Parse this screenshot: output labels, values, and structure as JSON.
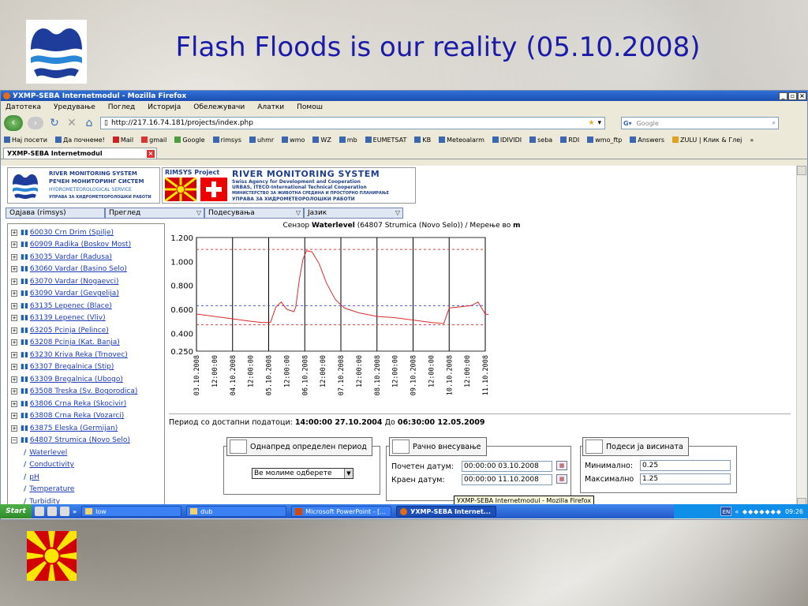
{
  "slide": {
    "title": "Flash Floods is our reality (05.10.2008)"
  },
  "browser": {
    "window_title": "УХМР-SEBA Internetmodul - Mozilla Firefox",
    "menu": [
      "Датотека",
      "Уредување",
      "Поглед",
      "Историја",
      "Обележувачи",
      "Алатки",
      "Помош"
    ],
    "url": "http://217.16.74.181/projects/index.php",
    "search_placeholder": "Google",
    "bookmarks": [
      "Нај посети",
      "Да почнеме!",
      "Mail",
      "gmail",
      "Google",
      "rimsys",
      "uhmr",
      "wmo",
      "WZ",
      "mb",
      "EUMETSAT",
      "KB",
      "Meteoalarm",
      "IDIVIDI",
      "seba",
      "RDI",
      "wmo_ftp",
      "Answers",
      "ZULU | Клик & Глеј"
    ],
    "tab_label": "УХМР-SEBA Internetmodul"
  },
  "logos": {
    "left": {
      "line1": "RIVER MONITORING SYSTEM",
      "line2": "РЕЧЕН МОНИТОРИНГ СИСТЕМ",
      "line3": "HYDROMETEOROLOGICAL SERVICE",
      "line4": "УПРАВА ЗА ХИДРОМЕТЕОРОЛОШКИ РАБОТИ"
    },
    "right": {
      "project": "RIMSYS Project",
      "line1": "RIVER MONITORING SYSTEM",
      "line2": "Swiss Agency for Development and Cooperation",
      "line3": "URBAS, ITECO-International Technical Cooperation",
      "line4": "МИНИСТЕРСТВО ЗА ЖИВОТНА СРЕДИНА И ПРОСТОРНО ПЛАНИРАЊЕ",
      "line5": "УПРАВА ЗА ХИДРОМЕТЕОРОЛОШКИ РАБОТИ"
    }
  },
  "app_menu": [
    "Одјава (rimsys)",
    "Преглед",
    "Подесувања",
    "Јазик"
  ],
  "stations": [
    "60030 Crn Drim (Spilje)",
    "60909 Radika (Boskov Most)",
    "63035 Vardar (Radusa)",
    "63060 Vardar (Basino Selo)",
    "63070 Vardar (Nogaevci)",
    "63090 Vardar (Gevgelija)",
    "63135 Lepenec (Blace)",
    "63139 Lepenec (Vliv)",
    "63205 Pcinja (Pelince)",
    "63208 Pcinja (Kat. Banja)",
    "63230 Kriva Reka (Trnovec)",
    "63307 Bregalnica (Stip)",
    "63309 Bregalnica (Ubogo)",
    "63508 Treska (Sv. Bogorodica)",
    "63806 Crna Reka (Skocivir)",
    "63808 Crna Reka (Vozarci)",
    "63875 Eleska (Germijan)",
    "64807 Strumica (Novo Selo)"
  ],
  "station_children": [
    "Waterlevel",
    "Conductivity",
    "pH",
    "Temperature",
    "Turbidity"
  ],
  "chart_caption": {
    "prefix": "Сензор",
    "sensor": "Waterlevel",
    "station": "(64807 Strumica (Novo Selo))",
    "unit_text": "/ Мерење во",
    "unit": "m"
  },
  "chart_data": {
    "type": "line",
    "title": "Сензор Waterlevel (64807 Strumica (Novo Selo)) / Мерење во m",
    "xlabel": "",
    "ylabel": "",
    "ylim": [
      0.25,
      1.2
    ],
    "yticks": [
      "1.200",
      "1.000",
      "0.800",
      "0.600",
      "0.400",
      "0.250"
    ],
    "xticks": [
      "03.10.2008",
      "12:00:00",
      "04.10.2008",
      "12:00:00",
      "05.10.2008",
      "12:00:00",
      "06.10.2008",
      "12:00:00",
      "07.10.2008",
      "12:00:00",
      "08.10.2008",
      "12:00:00",
      "09.10.2008",
      "12:00:00",
      "10.10.2008",
      "12:00:00",
      "11.10.2008"
    ],
    "day_markers": [
      0,
      1,
      2,
      3,
      4,
      5,
      6,
      7,
      8
    ],
    "x_unit": "days since 03.10.2008",
    "reference_lines": [
      {
        "value": 1.1,
        "color": "#e04040",
        "style": "dashed"
      },
      {
        "value": 0.63,
        "color": "#4a5ad8",
        "style": "dashed"
      },
      {
        "value": 0.47,
        "color": "#e04040",
        "style": "dashed"
      }
    ],
    "series": [
      {
        "color": "#dd2a2a",
        "points": [
          [
            0.0,
            0.56
          ],
          [
            0.5,
            0.54
          ],
          [
            1.0,
            0.52
          ],
          [
            1.5,
            0.5
          ],
          [
            1.8,
            0.49
          ],
          [
            2.05,
            0.49
          ],
          [
            2.2,
            0.62
          ],
          [
            2.35,
            0.66
          ],
          [
            2.5,
            0.6
          ],
          [
            2.7,
            0.58
          ],
          [
            2.75,
            0.62
          ],
          [
            2.85,
            0.85
          ],
          [
            2.95,
            1.02
          ],
          [
            3.05,
            1.09
          ],
          [
            3.2,
            1.08
          ],
          [
            3.4,
            0.98
          ],
          [
            3.6,
            0.82
          ],
          [
            3.85,
            0.68
          ],
          [
            4.1,
            0.61
          ],
          [
            4.5,
            0.57
          ],
          [
            5.0,
            0.54
          ],
          [
            5.5,
            0.53
          ],
          [
            6.0,
            0.51
          ],
          [
            6.5,
            0.49
          ],
          [
            6.85,
            0.48
          ],
          [
            7.0,
            0.61
          ],
          [
            7.3,
            0.62
          ],
          [
            7.6,
            0.63
          ],
          [
            7.8,
            0.66
          ],
          [
            8.0,
            0.56
          ],
          [
            8.2,
            0.55
          ],
          [
            8.5,
            0.57
          ],
          [
            8.9,
            0.58
          ]
        ]
      }
    ]
  },
  "period": {
    "label": "Период со достапни податоци:",
    "from": "14:00:00 27.10.2004",
    "to_label": "До",
    "to": "06:30:00 12.05.2009"
  },
  "panel_predefined": {
    "legend": "Однапред определен период",
    "select_value": "Ве молиме одберете"
  },
  "panel_manual": {
    "legend": "Рачно внесување",
    "start_label": "Почетен датум:",
    "start_value": "00:00:00 03.10.2008",
    "end_label": "Краен датум:",
    "end_value": "00:00:00 11.10.2008"
  },
  "panel_heights": {
    "legend": "Подеси ја висината",
    "min_label": "Минимално:",
    "min_value": "0.25",
    "max_label": "Максимално",
    "max_value": "1.25"
  },
  "tooltip": "УХМР-SEBA Internetmodul - Mozilla Firefox",
  "taskbar": {
    "start": "Start",
    "items": [
      "low",
      "dub",
      "Microsoft PowerPoint - [...",
      "УХМР-SEBA Internet..."
    ],
    "lang": "EN",
    "clock": "09:26"
  },
  "colors": {
    "slide_title": "#1a1aa8",
    "link": "#1d3ab8",
    "series": "#dd2a2a",
    "upper_threshold": "#e04040",
    "mid_threshold": "#4a5ad8"
  }
}
